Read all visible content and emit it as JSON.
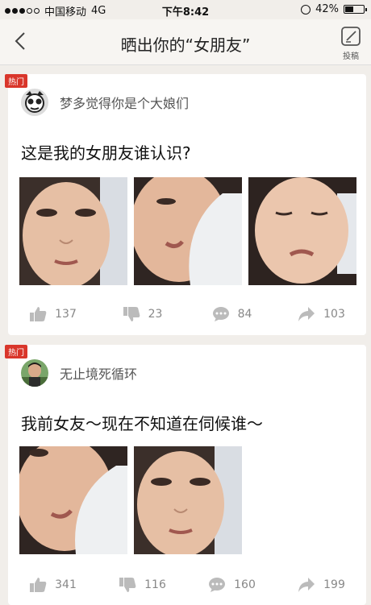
{
  "status_bar": {
    "carrier": "中国移动",
    "network": "4G",
    "time": "下午8:42",
    "battery": "42%",
    "battery_level": 0.42
  },
  "nav": {
    "title": "晒出你的“女朋友”",
    "post_label": "投稿"
  },
  "posts": [
    {
      "badge": "热门",
      "username": "梦多觉得你是个大娘们",
      "content": "这是我的女朋友谁认识?",
      "likes": "137",
      "dislikes": "23",
      "comments": "84",
      "shares": "103"
    },
    {
      "badge": "热门",
      "username": "无止境死循环",
      "content": "我前女友～现在不知道在伺候谁～",
      "likes": "341",
      "dislikes": "116",
      "comments": "160",
      "shares": "199"
    }
  ],
  "colors": {
    "accent": "#d9362b",
    "background": "#f1eeea",
    "card": "#ffffff"
  }
}
